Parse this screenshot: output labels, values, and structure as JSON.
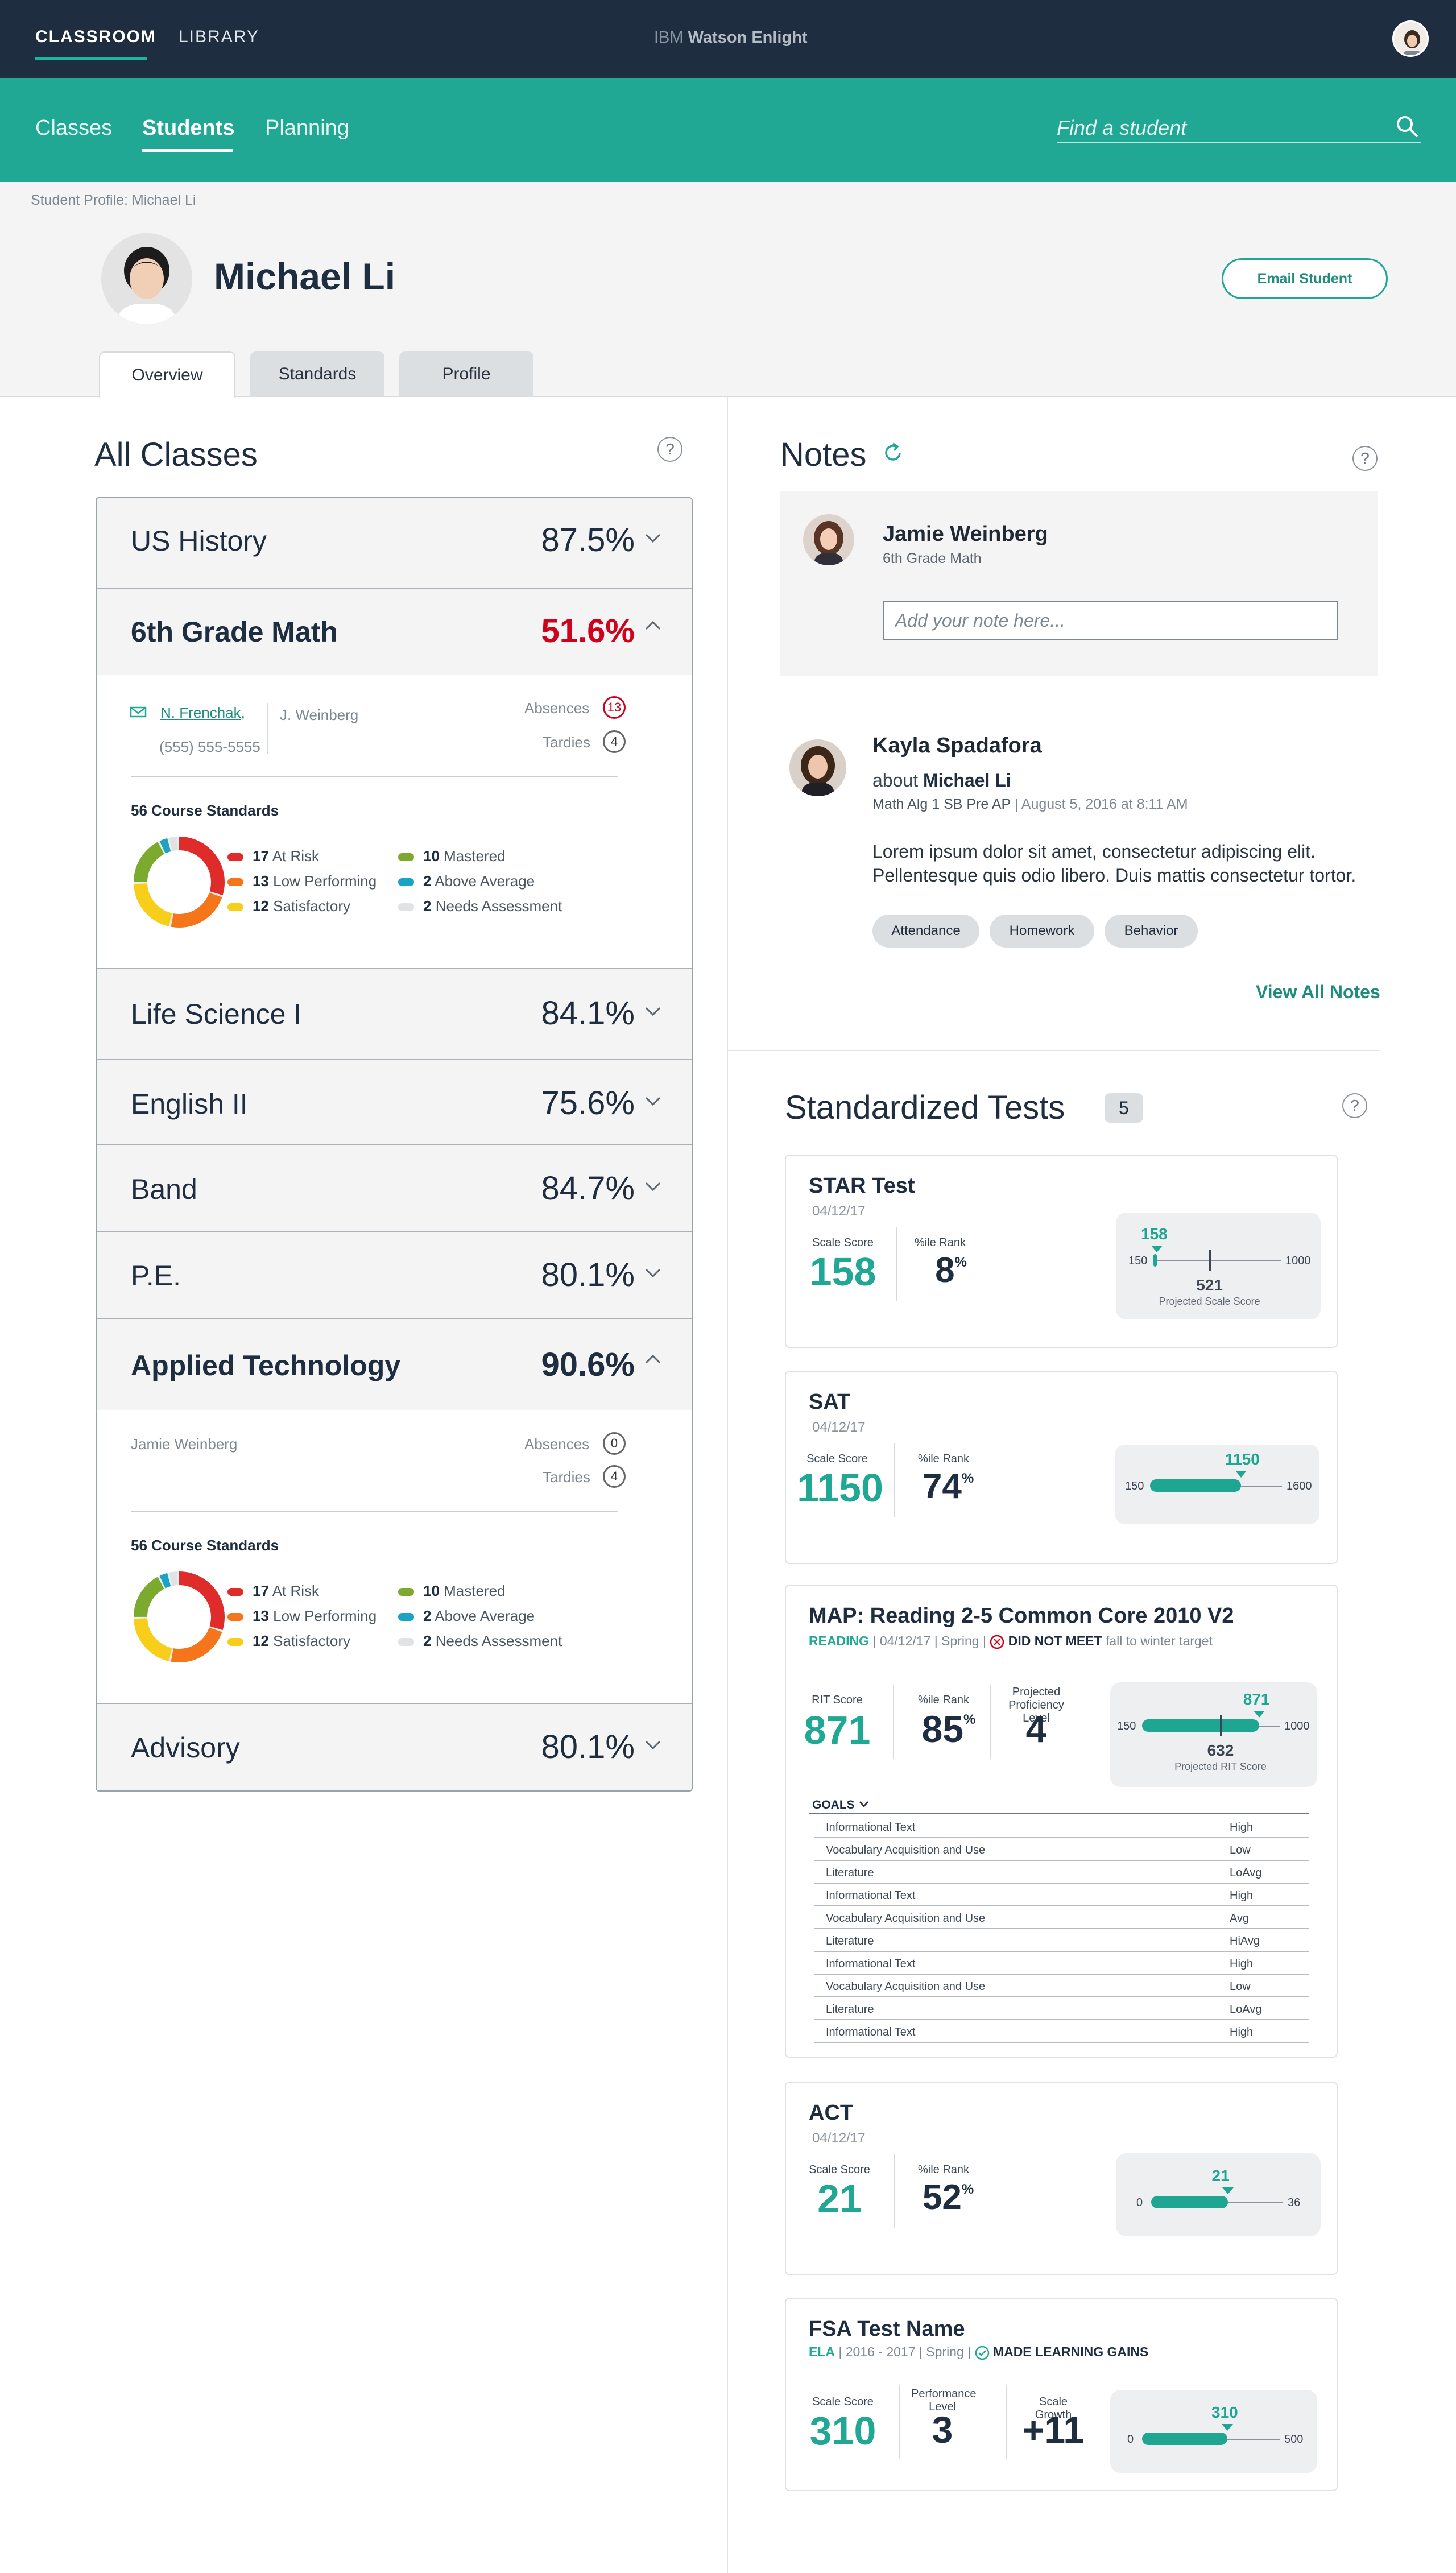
{
  "topbar": {
    "tab_classroom": "CLASSROOM",
    "tab_library": "LIBRARY",
    "brand_prefix": "IBM",
    "brand_name": "Watson Enlight"
  },
  "subnav": {
    "items": [
      "Classes",
      "Students",
      "Planning"
    ],
    "search_placeholder": "Find a student"
  },
  "profile": {
    "breadcrumb": "Student Profile: Michael Li",
    "name": "Michael Li",
    "email_button": "Email Student",
    "tabs": [
      "Overview",
      "Standards",
      "Profile"
    ]
  },
  "classes": {
    "title": "All Classes",
    "help": "?",
    "rows": [
      {
        "name": "US History",
        "score": "87.5%"
      },
      {
        "name": "6th Grade Math",
        "score": "51.6%",
        "score_color": "#d0021b"
      },
      {
        "name": "Life Science I",
        "score": "84.1%"
      },
      {
        "name": "English II",
        "score": "75.6%"
      },
      {
        "name": "Band",
        "score": "84.7%"
      },
      {
        "name": "P.E.",
        "score": "80.1%"
      },
      {
        "name": "Applied Technology",
        "score": "90.6%"
      },
      {
        "name": "Advisory",
        "score": "80.1%"
      }
    ],
    "math_detail": {
      "teacher_link": "N. Frenchak,",
      "phone": "(555) 555-5555",
      "coteacher": "J. Weinberg",
      "absences_label": "Absences",
      "absences": "13",
      "tardies_label": "Tardies",
      "tardies": "4"
    },
    "tech_detail": {
      "teacher": "Jamie Weinberg",
      "absences_label": "Absences",
      "absences": "0",
      "tardies_label": "Tardies",
      "tardies": "4"
    },
    "standards_label": "56 Course Standards",
    "legend": [
      {
        "count": "17",
        "label": "At Risk",
        "color": "#e02b2b",
        "value": 17
      },
      {
        "count": "13",
        "label": "Low Performing",
        "color": "#f5761a",
        "value": 13
      },
      {
        "count": "12",
        "label": "Satisfactory",
        "color": "#f7cf1b",
        "value": 12
      },
      {
        "count": "10",
        "label": "Mastered",
        "color": "#7caa2e",
        "value": 10
      },
      {
        "count": "2",
        "label": "Above Average",
        "color": "#1aa3c2",
        "value": 2
      },
      {
        "count": "2",
        "label": "Needs Assessment",
        "color": "#e0e2e4",
        "value": 2
      }
    ]
  },
  "notes": {
    "title": "Notes",
    "compose": {
      "author": "Jamie Weinberg",
      "class": "6th Grade Math",
      "placeholder": "Add your note here..."
    },
    "note": {
      "author": "Kayla Spadafora",
      "about_prefix": "about",
      "about_name": "Michael Li",
      "class": "Math Alg 1 SB Pre AP",
      "date": "| August 5, 2016 at 8:11 AM",
      "body": "Lorem ipsum dolor sit amet, consectetur adipiscing elit. Pellentesque quis odio libero. Duis mattis consectetur tortor.",
      "tags": [
        "Attendance",
        "Homework",
        "Behavior"
      ]
    },
    "view_all": "View All Notes"
  },
  "tests": {
    "title": "Standardized Tests",
    "count": "5",
    "star": {
      "name": "STAR Test",
      "date": "04/12/17",
      "score_label": "Scale Score",
      "score": "158",
      "rank_label": "%ile Rank",
      "rank": "8",
      "rank_suffix": "%",
      "lo": "150",
      "hi": "1000",
      "marker": "158",
      "projected": "521",
      "projected_label": "Projected Scale Score",
      "fill": 0.01,
      "proj_pos": 0.44
    },
    "sat": {
      "name": "SAT",
      "date": "04/12/17",
      "score_label": "Scale Score",
      "score": "1150",
      "rank_label": "%ile Rank",
      "rank": "74",
      "rank_suffix": "%",
      "lo": "150",
      "hi": "1600",
      "marker": "1150",
      "fill": 0.69
    },
    "map": {
      "name": "MAP: Reading 2-5 Common Core 2010 V2",
      "subject": "READING",
      "meta": "| 04/12/17 | Spring |",
      "status": "DID NOT MEET",
      "status_suffix": "fall to winter target",
      "rit_label": "RIT Score",
      "rit": "871",
      "rank_label": "%ile Rank",
      "rank": "85",
      "rank_suffix": "%",
      "prof_label": "Projected Proficiency Level",
      "prof": "4",
      "lo": "150",
      "hi": "1000",
      "marker": "871",
      "projected": "632",
      "projected_label": "Projected RIT Score",
      "fill": 0.85,
      "proj_pos": 0.57,
      "goals_label": "GOALS",
      "goals": [
        {
          "name": "Informational Text",
          "level": "High"
        },
        {
          "name": "Vocabulary Acquisition and Use",
          "level": "Low"
        },
        {
          "name": "Literature",
          "level": "LoAvg"
        },
        {
          "name": "Informational Text",
          "level": "High"
        },
        {
          "name": "Vocabulary Acquisition and Use",
          "level": "Avg"
        },
        {
          "name": "Literature",
          "level": "HiAvg"
        },
        {
          "name": "Informational Text",
          "level": "High"
        },
        {
          "name": "Vocabulary Acquisition and Use",
          "level": "Low"
        },
        {
          "name": "Literature",
          "level": "LoAvg"
        },
        {
          "name": "Informational Text",
          "level": "High"
        }
      ]
    },
    "act": {
      "name": "ACT",
      "date": "04/12/17",
      "score_label": "Scale Score",
      "score": "21",
      "rank_label": "%ile Rank",
      "rank": "52",
      "rank_suffix": "%",
      "lo": "0",
      "hi": "36",
      "marker": "21",
      "fill": 0.58
    },
    "fsa": {
      "name": "FSA Test Name",
      "subject": "ELA",
      "meta": "| 2016 - 2017 | Spring |",
      "status": "MADE LEARNING GAINS",
      "score_label": "Scale Score",
      "score": "310",
      "level_label": "Performance Level",
      "level": "3",
      "growth_label": "Scale Growth",
      "growth": "+11",
      "lo": "0",
      "hi": "500",
      "marker": "310",
      "fill": 0.62
    }
  }
}
